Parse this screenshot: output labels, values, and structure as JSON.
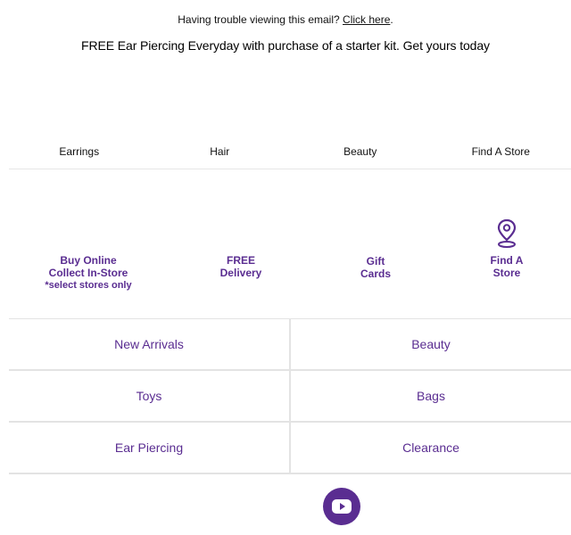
{
  "preheader": {
    "text": "Having trouble viewing this email?",
    "link_label": "Click here",
    "suffix": "."
  },
  "promo": {
    "text": "FREE Ear Piercing Everyday with purchase of a starter kit. Get yours today"
  },
  "nav": {
    "items": [
      "Earrings",
      "Hair",
      "Beauty",
      "Find A Store"
    ]
  },
  "services": {
    "buy_online": {
      "line1": "Buy Online",
      "line2": "Collect In-Store",
      "note": "*select stores only"
    },
    "delivery": {
      "line1": "FREE",
      "line2": "Delivery"
    },
    "gift_cards": {
      "line1": "Gift",
      "line2": "Cards"
    },
    "find_store": {
      "line1": "Find A",
      "line2": "Store",
      "icon": "map-pin-icon"
    }
  },
  "categories": {
    "rows": [
      [
        "New Arrivals",
        "Beauty"
      ],
      [
        "Toys",
        "Bags"
      ],
      [
        "Ear Piercing",
        "Clearance"
      ]
    ]
  },
  "social": {
    "icon": "youtube-icon"
  },
  "colors": {
    "brand_purple": "#5a2d91",
    "divider": "#e3e3e3",
    "text": "#111111"
  }
}
